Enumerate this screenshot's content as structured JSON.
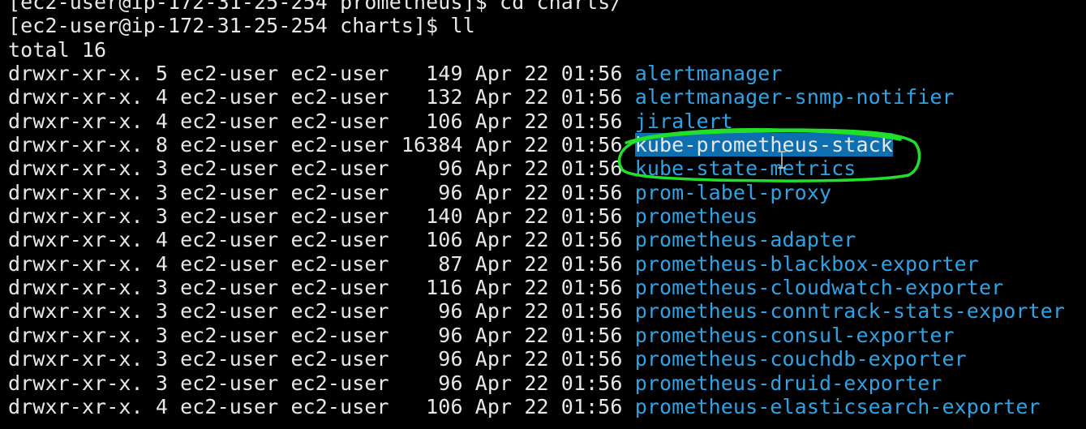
{
  "terminal": {
    "prompt_lines": [
      {
        "text": "[ec2-user@ip-172-31-25-254 prometheus]$ cd charts/"
      },
      {
        "text": "[ec2-user@ip-172-31-25-254 charts]$ ll"
      },
      {
        "text": "total 16"
      }
    ],
    "listing": [
      {
        "meta": "drwxr-xr-x. 5 ec2-user ec2-user   149 Apr 22 01:56 ",
        "name": "alertmanager"
      },
      {
        "meta": "drwxr-xr-x. 4 ec2-user ec2-user   132 Apr 22 01:56 ",
        "name": "alertmanager-snmp-notifier"
      },
      {
        "meta": "drwxr-xr-x. 4 ec2-user ec2-user   106 Apr 22 01:56 ",
        "name": "jiralert"
      },
      {
        "meta": "drwxr-xr-x. 8 ec2-user ec2-user 16384 Apr 22 01:56 ",
        "name": "kube-prometheus-stack"
      },
      {
        "meta": "drwxr-xr-x. 3 ec2-user ec2-user    96 Apr 22 01:56 ",
        "name": "kube-state-metrics"
      },
      {
        "meta": "drwxr-xr-x. 3 ec2-user ec2-user    96 Apr 22 01:56 ",
        "name": "prom-label-proxy"
      },
      {
        "meta": "drwxr-xr-x. 3 ec2-user ec2-user   140 Apr 22 01:56 ",
        "name": "prometheus"
      },
      {
        "meta": "drwxr-xr-x. 4 ec2-user ec2-user   106 Apr 22 01:56 ",
        "name": "prometheus-adapter"
      },
      {
        "meta": "drwxr-xr-x. 4 ec2-user ec2-user    87 Apr 22 01:56 ",
        "name": "prometheus-blackbox-exporter"
      },
      {
        "meta": "drwxr-xr-x. 3 ec2-user ec2-user   116 Apr 22 01:56 ",
        "name": "prometheus-cloudwatch-exporter"
      },
      {
        "meta": "drwxr-xr-x. 3 ec2-user ec2-user    96 Apr 22 01:56 ",
        "name": "prometheus-conntrack-stats-exporter"
      },
      {
        "meta": "drwxr-xr-x. 3 ec2-user ec2-user    96 Apr 22 01:56 ",
        "name": "prometheus-consul-exporter"
      },
      {
        "meta": "drwxr-xr-x. 3 ec2-user ec2-user    96 Apr 22 01:56 ",
        "name": "prometheus-couchdb-exporter"
      },
      {
        "meta": "drwxr-xr-x. 3 ec2-user ec2-user    96 Apr 22 01:56 ",
        "name": "prometheus-druid-exporter"
      },
      {
        "meta": "drwxr-xr-x. 4 ec2-user ec2-user   106 Apr 22 01:56 ",
        "name": "prometheus-elasticsearch-exporter"
      }
    ],
    "selected_entry": "kube-prometheus-stack"
  },
  "colors": {
    "background": "#000000",
    "foreground": "#e8e8e8",
    "directory": "#2fa3e6",
    "selection": "#0d6fb0",
    "annotation": "#22e02a"
  },
  "icons": {
    "cursor": "i-beam-cursor-icon",
    "annotation": "hand-drawn-circle"
  }
}
